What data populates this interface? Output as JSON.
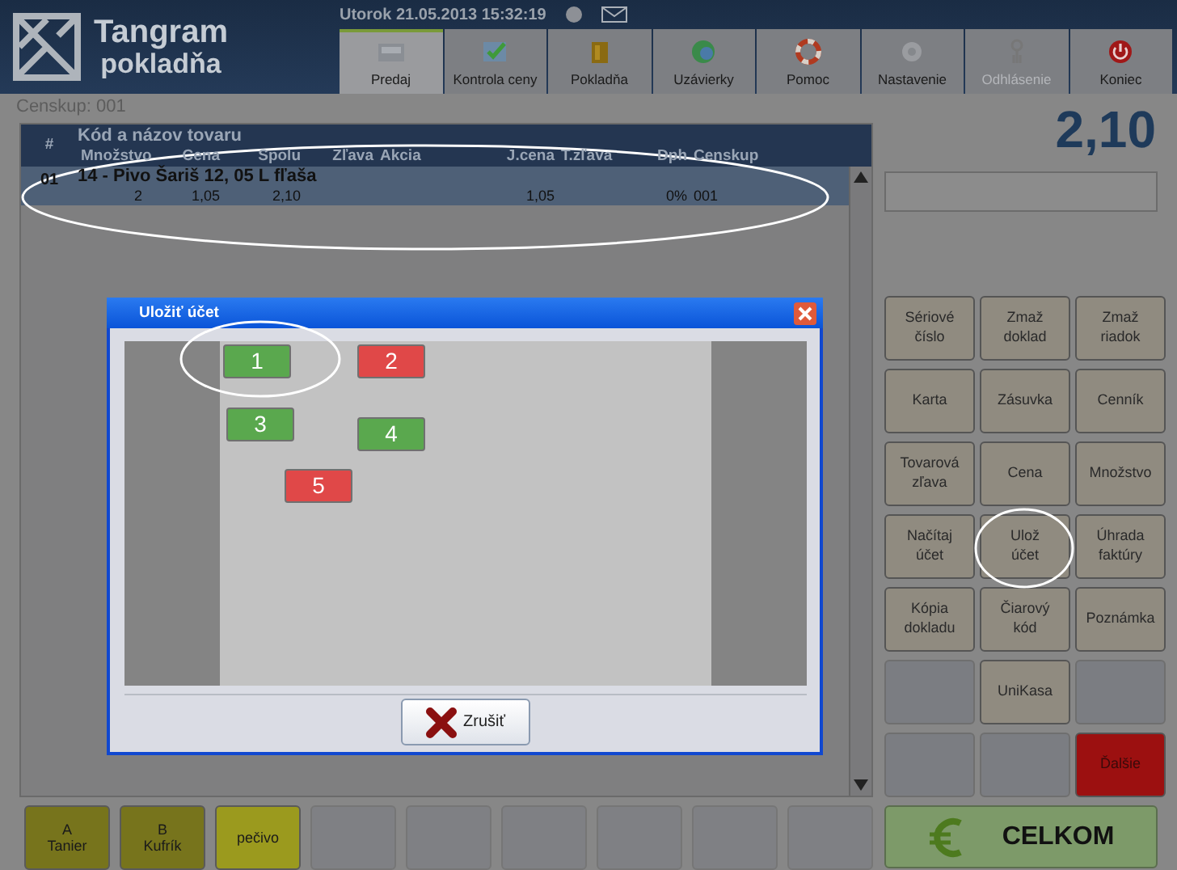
{
  "app": {
    "title": "Tangram",
    "subtitle": "pokladňa",
    "datetime": "Utorok 21.05.2013 15:32:19"
  },
  "tabs": [
    {
      "label": "Predaj",
      "selected": true,
      "disabled": false
    },
    {
      "label": "Kontrola ceny",
      "selected": false,
      "disabled": false
    },
    {
      "label": "Pokladňa",
      "selected": false,
      "disabled": false
    },
    {
      "label": "Uzávierky",
      "selected": false,
      "disabled": false
    },
    {
      "label": "Pomoc",
      "selected": false,
      "disabled": false
    },
    {
      "label": "Nastavenie",
      "selected": false,
      "disabled": false
    },
    {
      "label": "Odhlásenie",
      "selected": false,
      "disabled": true
    },
    {
      "label": "Koniec",
      "selected": false,
      "disabled": false
    }
  ],
  "price_group": "Censkup: 001",
  "table": {
    "title_column": "Kód a názov tovaru",
    "number_column": "#",
    "columns": [
      "Množstvo",
      "Cena",
      "Spolu",
      "Zľava",
      "Akcia",
      "J.cena",
      "T.zľava",
      "Dph",
      "Censkup"
    ],
    "rows": [
      {
        "number": "01",
        "name": "14 - Pivo Šariš 12, 05 L fľaša",
        "selected": true,
        "cells": [
          "2",
          "1,05",
          "2,10",
          "",
          "",
          "1,05",
          "",
          "0%",
          "001"
        ]
      }
    ]
  },
  "total": "2,10",
  "functions": [
    {
      "kind": "function",
      "lines": [
        "Sériové",
        "číslo"
      ]
    },
    {
      "kind": "function",
      "lines": [
        "Zmaž",
        "doklad"
      ]
    },
    {
      "kind": "function",
      "lines": [
        "Zmaž",
        "riadok"
      ]
    },
    {
      "kind": "function",
      "lines": [
        "Karta"
      ]
    },
    {
      "kind": "function",
      "lines": [
        "Zásuvka"
      ]
    },
    {
      "kind": "function",
      "lines": [
        "Cenník"
      ]
    },
    {
      "kind": "function",
      "lines": [
        "Tovarová",
        "zľava"
      ]
    },
    {
      "kind": "function",
      "lines": [
        "Cena"
      ]
    },
    {
      "kind": "function",
      "lines": [
        "Množstvo"
      ]
    },
    {
      "kind": "function",
      "lines": [
        "Načítaj",
        "účet"
      ]
    },
    {
      "kind": "function",
      "lines": [
        "Ulož",
        "účet"
      ]
    },
    {
      "kind": "function",
      "lines": [
        "Úhrada",
        "faktúry"
      ]
    },
    {
      "kind": "function",
      "lines": [
        "Kópia",
        "dokladu"
      ]
    },
    {
      "kind": "function",
      "lines": [
        "Čiarový",
        "kód"
      ]
    },
    {
      "kind": "function",
      "lines": [
        "Poznámka"
      ]
    },
    {
      "kind": "empty"
    },
    {
      "kind": "function",
      "lines": [
        "UniKasa"
      ]
    },
    {
      "kind": "empty"
    },
    {
      "kind": "empty"
    },
    {
      "kind": "empty"
    },
    {
      "kind": "danger",
      "lines": [
        "Ďalšie"
      ]
    }
  ],
  "total_button": "CELKOM",
  "quick_buttons": [
    {
      "kind": "olive",
      "lines": [
        "A",
        "Tanier"
      ]
    },
    {
      "kind": "olive",
      "lines": [
        "B",
        "Kufrík"
      ]
    },
    {
      "kind": "yellow",
      "lines": [
        "pečivo"
      ]
    },
    {
      "kind": "empty"
    },
    {
      "kind": "empty"
    },
    {
      "kind": "empty"
    },
    {
      "kind": "empty"
    },
    {
      "kind": "empty"
    },
    {
      "kind": "empty"
    }
  ],
  "dialog": {
    "title": "Uložiť účet",
    "cancel": "Zrušiť",
    "accounts": [
      {
        "label": "1",
        "color": "#5aa84e"
      },
      {
        "label": "2",
        "color": "#e04848"
      },
      {
        "label": "3",
        "color": "#5aa84e"
      },
      {
        "label": "4",
        "color": "#5aa84e"
      },
      {
        "label": "5",
        "color": "#e04848"
      }
    ]
  }
}
